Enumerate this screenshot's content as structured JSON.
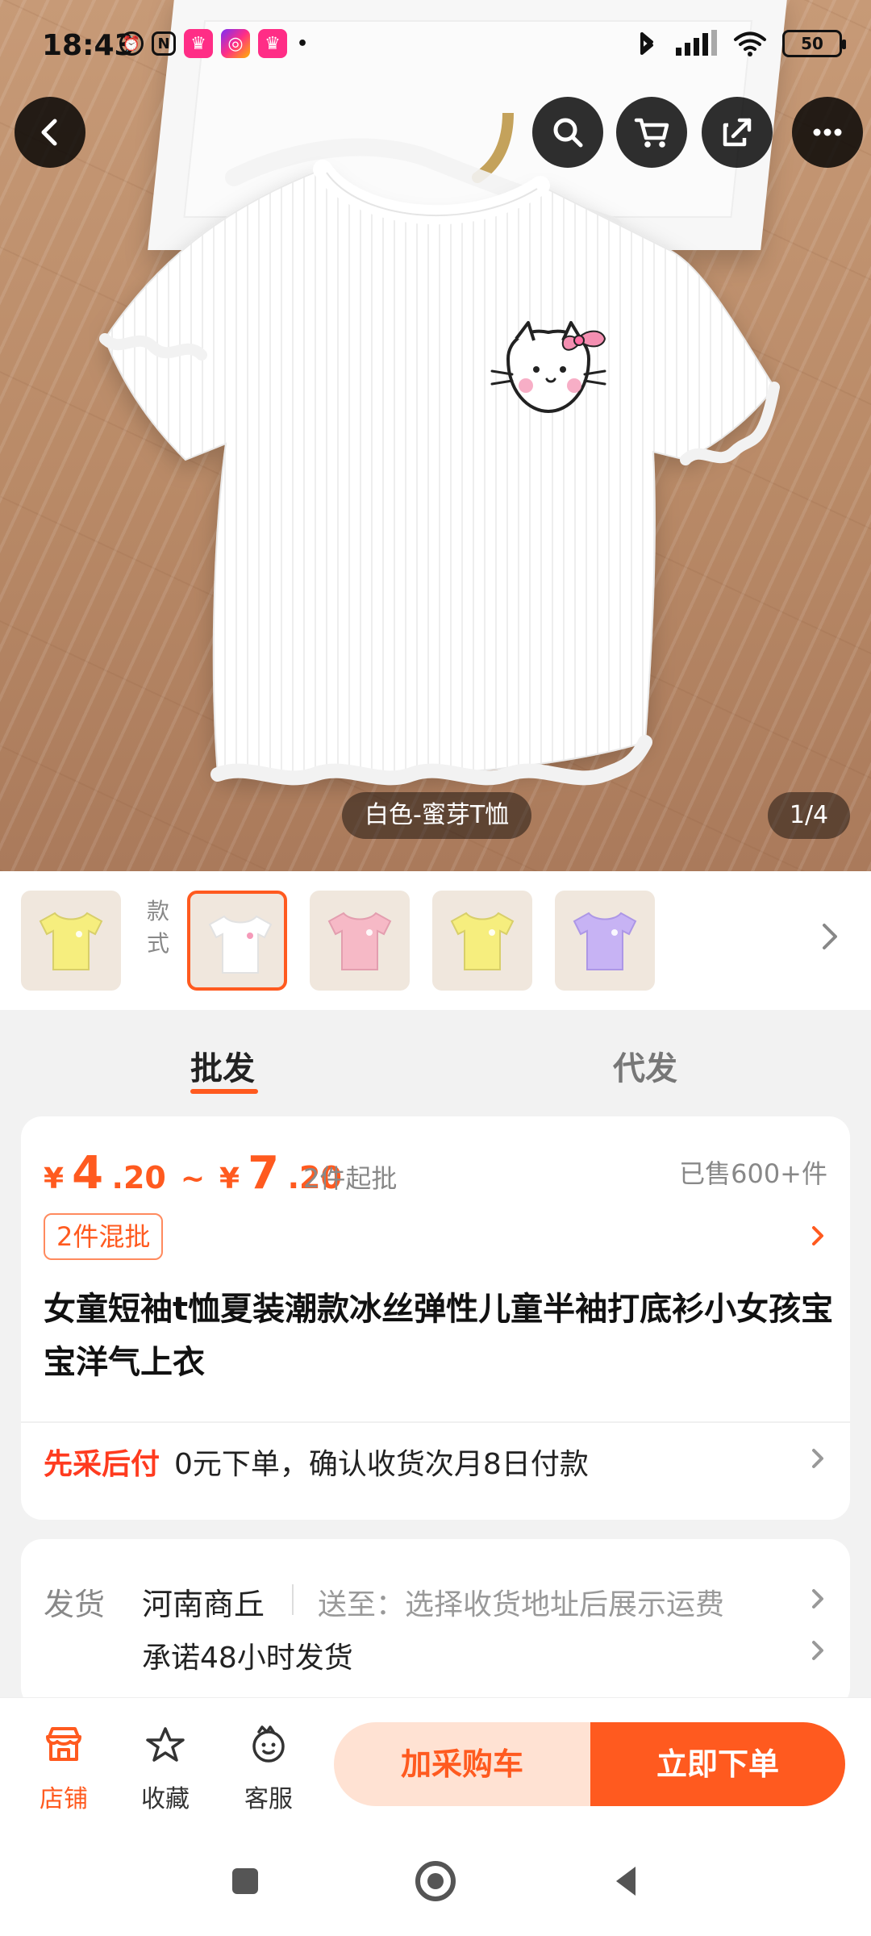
{
  "status_bar": {
    "time": "18:43",
    "battery": "50"
  },
  "hero": {
    "caption": "白色-蜜芽T恤",
    "pager": "1/4"
  },
  "top_actions": {
    "back_icon": "chevron-left-icon",
    "search_icon": "search-icon",
    "cart_icon": "cart-icon",
    "share_icon": "share-icon",
    "more_icon": "more-icon"
  },
  "thumbnails": {
    "style_label": "款式",
    "items": [
      {
        "color": "#f6ee7e",
        "selected": false
      },
      {
        "color": "#ffffff",
        "selected": true
      },
      {
        "color": "#f6b9c6",
        "selected": false
      },
      {
        "color": "#f6ee7e",
        "selected": false
      },
      {
        "color": "#c7b3f4",
        "selected": false
      }
    ]
  },
  "tabs": [
    {
      "label": "批发",
      "active": true
    },
    {
      "label": "代发",
      "active": false
    }
  ],
  "price_card": {
    "currency": "¥",
    "min_int": "4",
    "min_dec": ".20",
    "tilde": "~",
    "max_int": "7",
    "max_dec": ".20",
    "min_qty": "2件起批",
    "sold": "已售600+件",
    "tag": "2件混批",
    "title": "女童短袖t恤夏装潮款冰丝弹性儿童半袖打底衫小女孩宝宝洋气上衣",
    "pay_highlight": "先采后付",
    "pay_desc": "0元下单，确认收货次月8日付款"
  },
  "shipping": {
    "label": "发货",
    "from": "河南商丘",
    "to": "送至：选择收货地址后展示运费",
    "promise": "承诺48小时发货"
  },
  "bottom_bar": {
    "shop": "店铺",
    "favorite": "收藏",
    "service": "客服",
    "add_cart": "加采购车",
    "buy_now": "立即下单"
  },
  "colors": {
    "accent": "#ff5a1f",
    "accent_light": "#ffe2d3"
  }
}
